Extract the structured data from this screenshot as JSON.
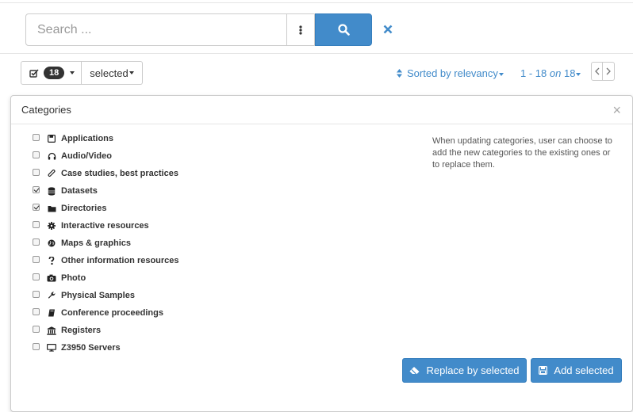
{
  "search": {
    "placeholder": "Search ..."
  },
  "toolbar": {
    "selected_count": "18",
    "selected_label": "selected"
  },
  "sort": {
    "label": "Sorted by relevancy"
  },
  "pager": {
    "range": "1 - 18",
    "on": "on",
    "total": "18"
  },
  "panel": {
    "title": "Categories",
    "close": "×",
    "help": "When updating categories, user can choose to add the new categories to the existing ones or to replace them.",
    "items": [
      {
        "label": "Applications",
        "icon": "save-icon",
        "checked": false
      },
      {
        "label": "Audio/Video",
        "icon": "headphones-icon",
        "checked": false
      },
      {
        "label": "Case studies, best practices",
        "icon": "paperclip-icon",
        "checked": false
      },
      {
        "label": "Datasets",
        "icon": "database-icon",
        "checked": true
      },
      {
        "label": "Directories",
        "icon": "folder-icon",
        "checked": true
      },
      {
        "label": "Interactive resources",
        "icon": "cog-icon",
        "checked": false
      },
      {
        "label": "Maps & graphics",
        "icon": "globe-icon",
        "checked": false
      },
      {
        "label": "Other information resources",
        "icon": "question-icon",
        "checked": false
      },
      {
        "label": "Photo",
        "icon": "camera-icon",
        "checked": false
      },
      {
        "label": "Physical Samples",
        "icon": "wrench-icon",
        "checked": false
      },
      {
        "label": "Conference proceedings",
        "icon": "book-icon",
        "checked": false
      },
      {
        "label": "Registers",
        "icon": "bank-icon",
        "checked": false
      },
      {
        "label": "Z3950 Servers",
        "icon": "desktop-icon",
        "checked": false
      }
    ],
    "replace_label": "Replace by selected",
    "add_label": "Add selected"
  },
  "colors": {
    "primary": "#428bca",
    "link": "#428bca"
  }
}
